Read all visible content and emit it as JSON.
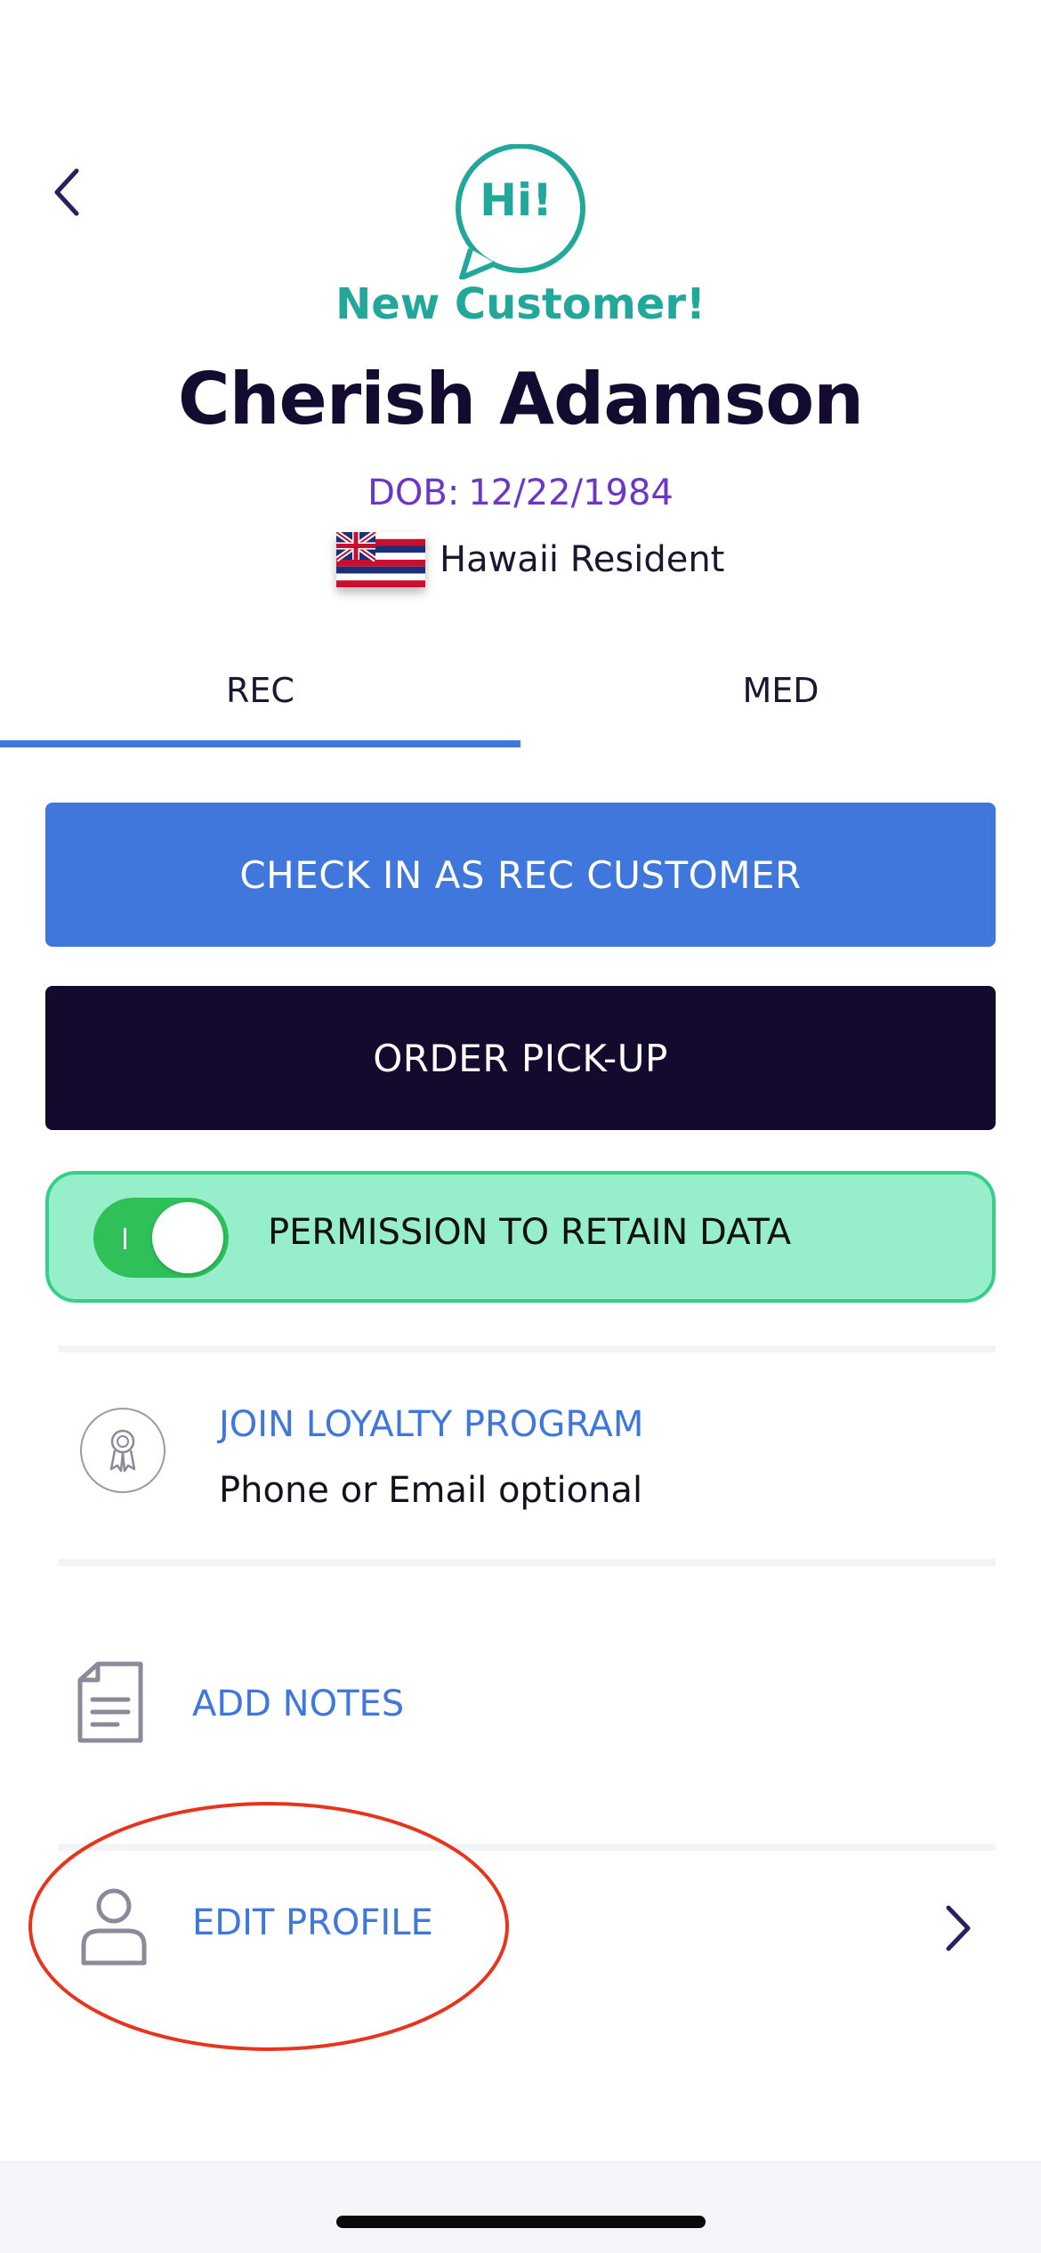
{
  "header": {
    "greeting_bubble": "Hi!",
    "status": "New Customer!",
    "customer_name": "Cherish Adamson",
    "dob_label": "DOB:",
    "dob_value": "12/22/1984",
    "residency": "Hawaii Resident"
  },
  "tabs": [
    {
      "label": "REC",
      "active": true
    },
    {
      "label": "MED",
      "active": false
    }
  ],
  "actions": {
    "check_in_label": "CHECK IN AS REC CUSTOMER",
    "order_pickup_label": "ORDER PICK-UP"
  },
  "permission": {
    "label": "PERMISSION TO RETAIN DATA",
    "enabled": true
  },
  "loyalty": {
    "title": "JOIN LOYALTY PROGRAM",
    "subtitle": "Phone or Email optional",
    "icon": "ribbon-award-icon"
  },
  "notes": {
    "label": "ADD NOTES",
    "icon": "document-icon"
  },
  "profile": {
    "label": "EDIT PROFILE",
    "icon": "person-icon"
  },
  "colors": {
    "accent_blue": "#3f77dc",
    "dark_navy": "#130a2e",
    "teal": "#22a89a",
    "purple": "#6a37c8",
    "permission_bg": "#96efca",
    "toggle_on": "#2fc05a",
    "annotation_red": "#e8341c"
  }
}
